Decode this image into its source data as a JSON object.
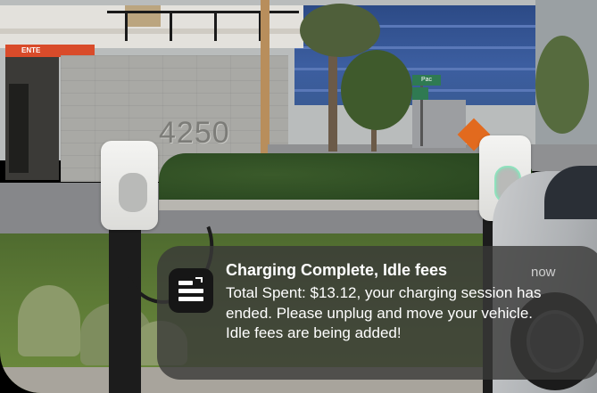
{
  "scene": {
    "building_address": "4250",
    "entrance_sign": "ENTE",
    "street_sign": "Pac"
  },
  "notification": {
    "app_icon": "charging-app-icon",
    "title": "Charging Complete, Idle fees",
    "time": "now",
    "body": "Total Spent: $13.12, your charging session has ended. Please unplug and move your vehicle. Idle fees are being added!"
  }
}
